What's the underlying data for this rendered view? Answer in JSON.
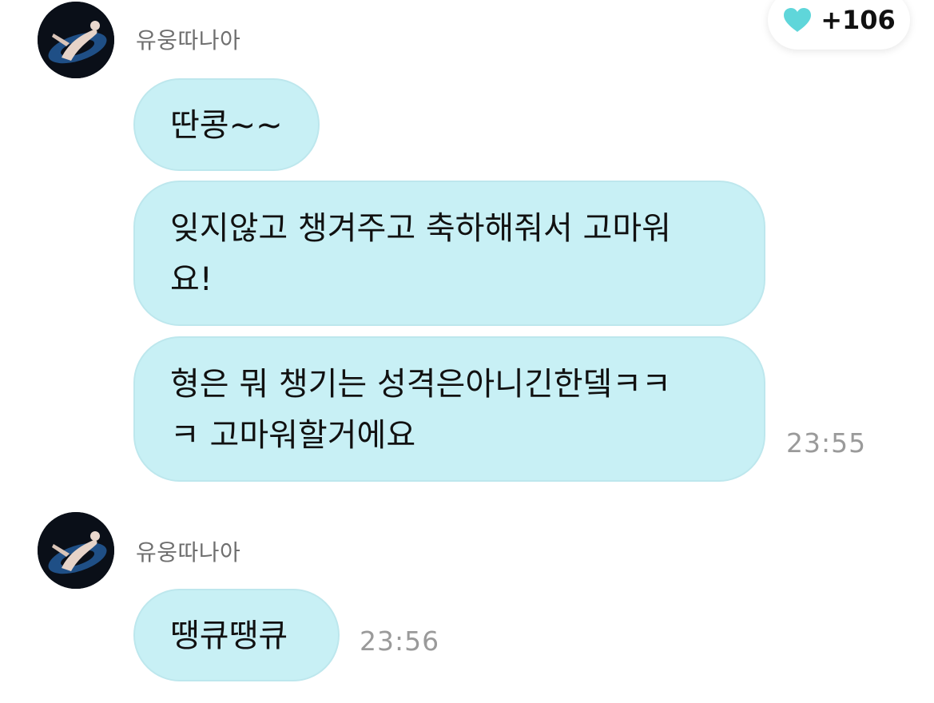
{
  "reaction": {
    "icon": "heart-icon",
    "count": "+106",
    "color": "#5fd6da"
  },
  "colors": {
    "bubble": "#c8f0f5",
    "name": "#6f6f6f",
    "time": "#9a9a9a"
  },
  "groups": [
    {
      "sender": "유웅따나아",
      "messages": [
        {
          "text": "딴콩~~"
        },
        {
          "text": "잊지않고 챙겨주고 축하해줘서 고마워\n요!"
        },
        {
          "text": "형은 뭐 챙기는 성격은아니긴한뎈ㅋㅋ\nㅋ 고마워할거에요",
          "time": "23:55"
        }
      ]
    },
    {
      "sender": "유웅따나아",
      "messages": [
        {
          "text": "땡큐땡큐",
          "time": "23:56"
        }
      ]
    }
  ]
}
